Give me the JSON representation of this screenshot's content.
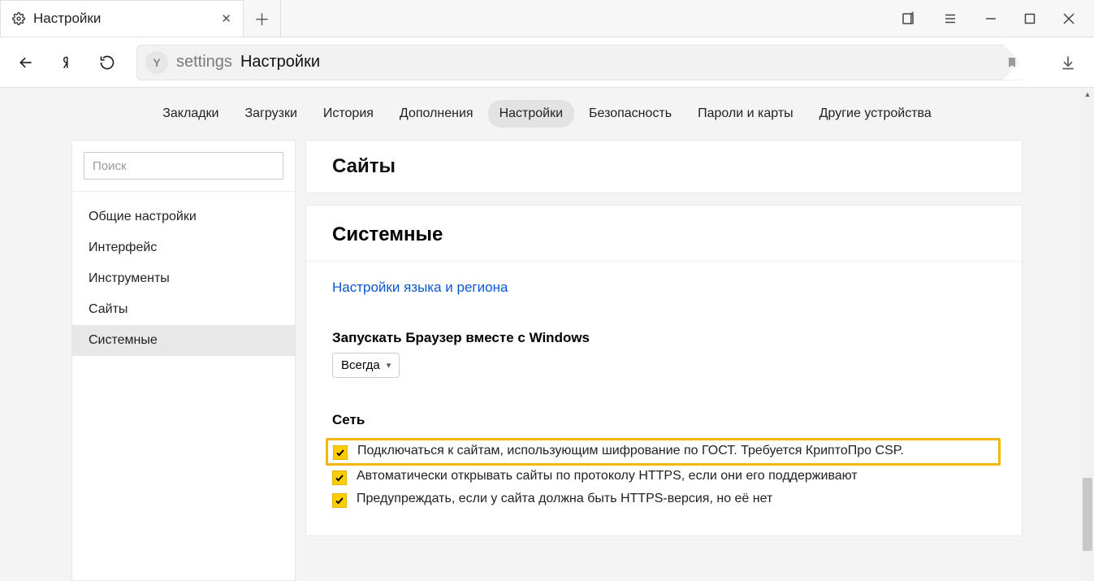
{
  "tab": {
    "title": "Настройки"
  },
  "address": {
    "segment1": "settings",
    "segment2": "Настройки"
  },
  "topnav": {
    "items": [
      {
        "label": "Закладки"
      },
      {
        "label": "Загрузки"
      },
      {
        "label": "История"
      },
      {
        "label": "Дополнения"
      },
      {
        "label": "Настройки",
        "active": true
      },
      {
        "label": "Безопасность"
      },
      {
        "label": "Пароли и карты"
      },
      {
        "label": "Другие устройства"
      }
    ]
  },
  "sidebar": {
    "search_placeholder": "Поиск",
    "items": [
      {
        "label": "Общие настройки"
      },
      {
        "label": "Интерфейс"
      },
      {
        "label": "Инструменты"
      },
      {
        "label": "Сайты"
      },
      {
        "label": "Системные",
        "active": true
      }
    ]
  },
  "sections": {
    "sites_heading": "Сайты",
    "system_heading": "Системные",
    "lang_link": "Настройки языка и региона",
    "startup_label": "Запускать Браузер вместе с Windows",
    "startup_value": "Всегда",
    "network_heading": "Сеть",
    "checks": [
      {
        "label": "Подключаться к сайтам, использующим шифрование по ГОСТ. Требуется КриптоПро CSP.",
        "checked": true,
        "highlight": true
      },
      {
        "label": "Автоматически открывать сайты по протоколу HTTPS, если они его поддерживают",
        "checked": true
      },
      {
        "label": "Предупреждать, если у сайта должна быть HTTPS-версия, но её нет",
        "checked": true
      }
    ]
  }
}
